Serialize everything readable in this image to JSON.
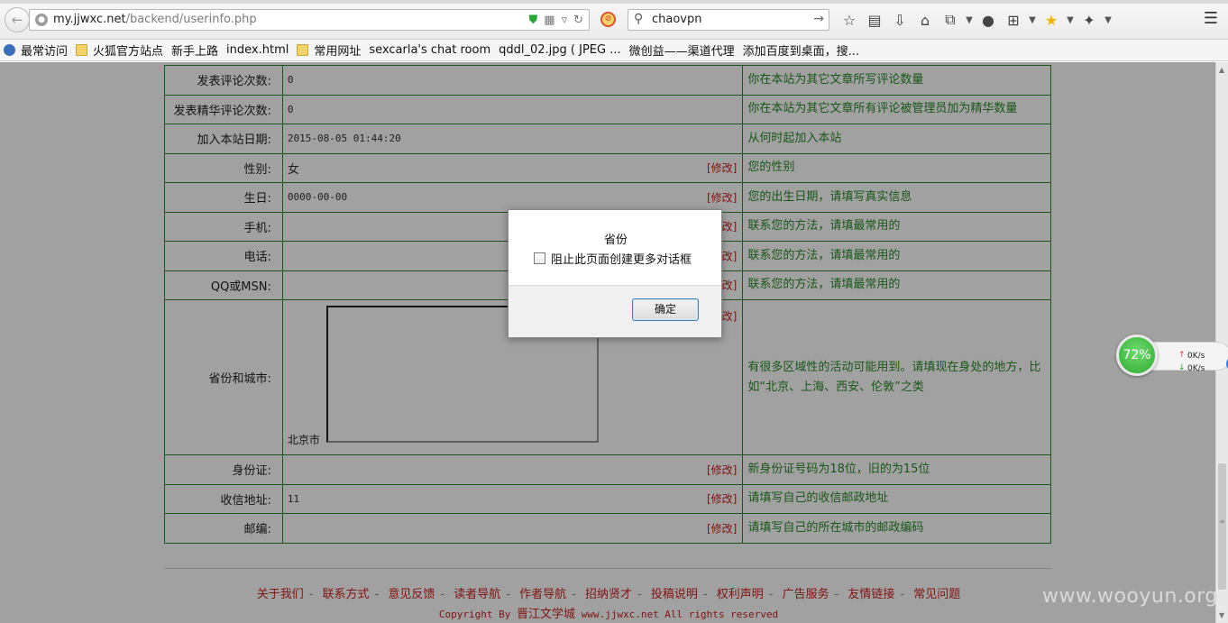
{
  "browser": {
    "url_domain": "my.jjwxc.net",
    "url_path": "/backend/userinfo.php",
    "search_value": "chaovpn",
    "bookmarks": [
      {
        "label": "最常访问",
        "icon": "fox"
      },
      {
        "label": "火狐官方站点",
        "icon": "folder"
      },
      {
        "label": "新手上路",
        "icon": "page"
      },
      {
        "label": "index.html",
        "icon": "page"
      },
      {
        "label": "常用网址",
        "icon": "folder"
      },
      {
        "label": "sexcarla's chat room",
        "icon": "page"
      },
      {
        "label": "qddl_02.jpg ( JPEG ...",
        "icon": "page"
      },
      {
        "label": "微创益——渠道代理",
        "icon": "page"
      },
      {
        "label": "添加百度到桌面，搜...",
        "icon": "page"
      }
    ]
  },
  "edit_label": "[修改]",
  "rows": [
    {
      "label": "发表评论次数:",
      "value": "0",
      "editable": false,
      "desc": "你在本站为其它文章所写评论数量"
    },
    {
      "label": "发表精华评论次数:",
      "value": "0",
      "editable": false,
      "desc": "你在本站为其它文章所有评论被管理员加为精华数量"
    },
    {
      "label": "加入本站日期:",
      "value": "2015-08-05 01:44:20",
      "editable": false,
      "desc": "从何时起加入本站"
    },
    {
      "label": "性别:",
      "value": "女",
      "editable": true,
      "desc": "您的性别"
    },
    {
      "label": "生日:",
      "value": "0000-00-00",
      "editable": true,
      "desc": "您的出生日期，请填写真实信息"
    },
    {
      "label": "手机:",
      "value": "",
      "editable": true,
      "desc": "联系您的方法，请填最常用的"
    },
    {
      "label": "电话:",
      "value": "",
      "editable": true,
      "desc": "联系您的方法，请填最常用的"
    },
    {
      "label": "QQ或MSN:",
      "value": "",
      "editable": true,
      "desc": "联系您的方法，请填最常用的"
    },
    {
      "label": "省份和城市:",
      "value": "北京市",
      "editable": true,
      "desc": "有很多区域性的活动可能用到。请填现在身处的地方，比如“北京、上海、西安、伦敦”之类"
    },
    {
      "label": "身份证:",
      "value": "",
      "editable": true,
      "desc": "新身份证号码为18位，旧的为15位"
    },
    {
      "label": "收信地址:",
      "value": "11",
      "editable": true,
      "desc": "请填写自己的收信邮政地址"
    },
    {
      "label": "邮编:",
      "value": "",
      "editable": true,
      "desc": "请填写自己的所在城市的邮政编码"
    }
  ],
  "footer": {
    "links": [
      "关于我们",
      "联系方式",
      "意见反馈",
      "读者导航",
      "作者导航",
      "招纳贤才",
      "投稿说明",
      "权利声明",
      "广告服务",
      "友情链接",
      "常见问题"
    ],
    "separator": "-",
    "copyright_prefix": "Copyright By",
    "copyright_brand": "晋江文学城",
    "copyright_suffix": "www.jjwxc.net All rights reserved"
  },
  "dialog": {
    "message": "省份",
    "checkbox_label": "阻止此页面创建更多对话框",
    "checkbox_checked": false,
    "ok_label": "确定"
  },
  "speed_widget": {
    "percent": "72%",
    "upload": "0K/s",
    "download": "0K/s"
  },
  "watermark": "www.wooyun.org"
}
